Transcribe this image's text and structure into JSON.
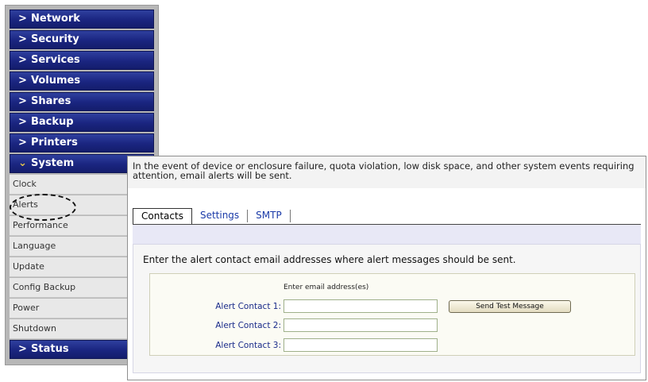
{
  "sidebar": {
    "top_items": [
      {
        "label": "Network"
      },
      {
        "label": "Security"
      },
      {
        "label": "Services"
      },
      {
        "label": "Volumes"
      },
      {
        "label": "Shares"
      },
      {
        "label": "Backup"
      },
      {
        "label": "Printers"
      }
    ],
    "system": {
      "label": "System"
    },
    "sub_items": [
      {
        "label": "Clock"
      },
      {
        "label": "Alerts"
      },
      {
        "label": "Performance"
      },
      {
        "label": "Language"
      },
      {
        "label": "Update"
      },
      {
        "label": "Config Backup"
      },
      {
        "label": "Power"
      },
      {
        "label": "Shutdown"
      }
    ],
    "status": {
      "label": "Status"
    },
    "collapsed_icon": "chevron-right-icon",
    "expanded_icon": "chevron-down-icon"
  },
  "panel": {
    "description": "In the event of device or enclosure failure, quota violation, low disk space, and other system events requiring attention, email alerts will be sent.",
    "tabs": [
      {
        "label": "Contacts",
        "active": true
      },
      {
        "label": "Settings",
        "active": false
      },
      {
        "label": "SMTP",
        "active": false
      }
    ],
    "instructions": "Enter the alert contact email addresses where alert messages should be sent.",
    "email_header": "Enter email address(es)",
    "contacts": [
      {
        "label": "Alert Contact 1:",
        "value": ""
      },
      {
        "label": "Alert Contact 2:",
        "value": ""
      },
      {
        "label": "Alert Contact 3:",
        "value": ""
      }
    ],
    "send_test_label": "Send Test Message"
  },
  "colors": {
    "nav_blue": "#1a2580",
    "link_blue": "#1a3aa8",
    "sidebar_gray": "#b7b7b7"
  }
}
